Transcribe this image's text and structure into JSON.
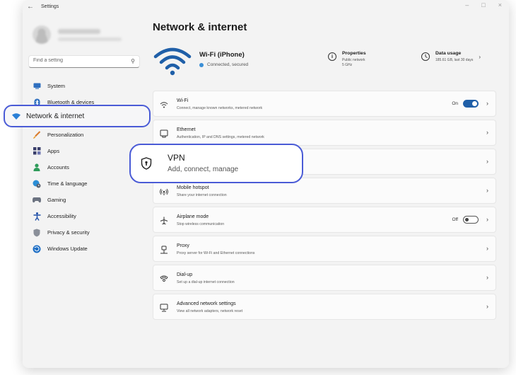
{
  "window": {
    "title": "Settings",
    "back_glyph": "←",
    "controls": [
      "–",
      "□",
      "×"
    ]
  },
  "search": {
    "placeholder": "Find a setting"
  },
  "sidebar": {
    "items": [
      {
        "label": "System",
        "icon": "monitor-icon"
      },
      {
        "label": "Bluetooth & devices",
        "icon": "bluetooth-icon"
      },
      {
        "label": "Network & internet",
        "icon": "wifi-icon",
        "active": true
      },
      {
        "label": "Personalization",
        "icon": "brush-icon"
      },
      {
        "label": "Apps",
        "icon": "apps-icon"
      },
      {
        "label": "Accounts",
        "icon": "person-icon"
      },
      {
        "label": "Time & language",
        "icon": "globe-clock-icon"
      },
      {
        "label": "Gaming",
        "icon": "gamepad-icon"
      },
      {
        "label": "Accessibility",
        "icon": "accessibility-icon"
      },
      {
        "label": "Privacy & security",
        "icon": "shield-icon"
      },
      {
        "label": "Windows Update",
        "icon": "update-icon"
      }
    ]
  },
  "main": {
    "title": "Network & internet",
    "hero": {
      "network_name": "Wi-Fi (iPhone)",
      "status": "Connected, secured",
      "properties": {
        "title": "Properties",
        "line1": "Public network",
        "line2": "5 GHz"
      },
      "data_usage": {
        "title": "Data usage",
        "line1": "185.61 GB, last 30 days"
      }
    },
    "cards": [
      {
        "title": "Wi-Fi",
        "subtitle": "Connect, manage known networks, metered network",
        "icon": "wifi-icon",
        "toggle": "On"
      },
      {
        "title": "Ethernet",
        "subtitle": "Authentication, IP and DNS settings, metered network",
        "icon": "ethernet-icon"
      },
      {
        "title": "VPN",
        "subtitle": "Add, connect, manage",
        "icon": "vpn-shield-icon"
      },
      {
        "title": "Mobile hotspot",
        "subtitle": "Share your internet connection",
        "icon": "hotspot-icon"
      },
      {
        "title": "Airplane mode",
        "subtitle": "Stop wireless communication",
        "icon": "airplane-icon",
        "toggle": "Off"
      },
      {
        "title": "Proxy",
        "subtitle": "Proxy server for Wi-Fi and Ethernet connections",
        "icon": "proxy-icon"
      },
      {
        "title": "Dial-up",
        "subtitle": "Set up a dial-up internet connection",
        "icon": "dialup-icon"
      },
      {
        "title": "Advanced network settings",
        "subtitle": "View all network adapters, network reset",
        "icon": "advanced-network-icon"
      }
    ]
  },
  "colors": {
    "accent": "#1f5fa8",
    "highlight": "#4a5bd6"
  }
}
